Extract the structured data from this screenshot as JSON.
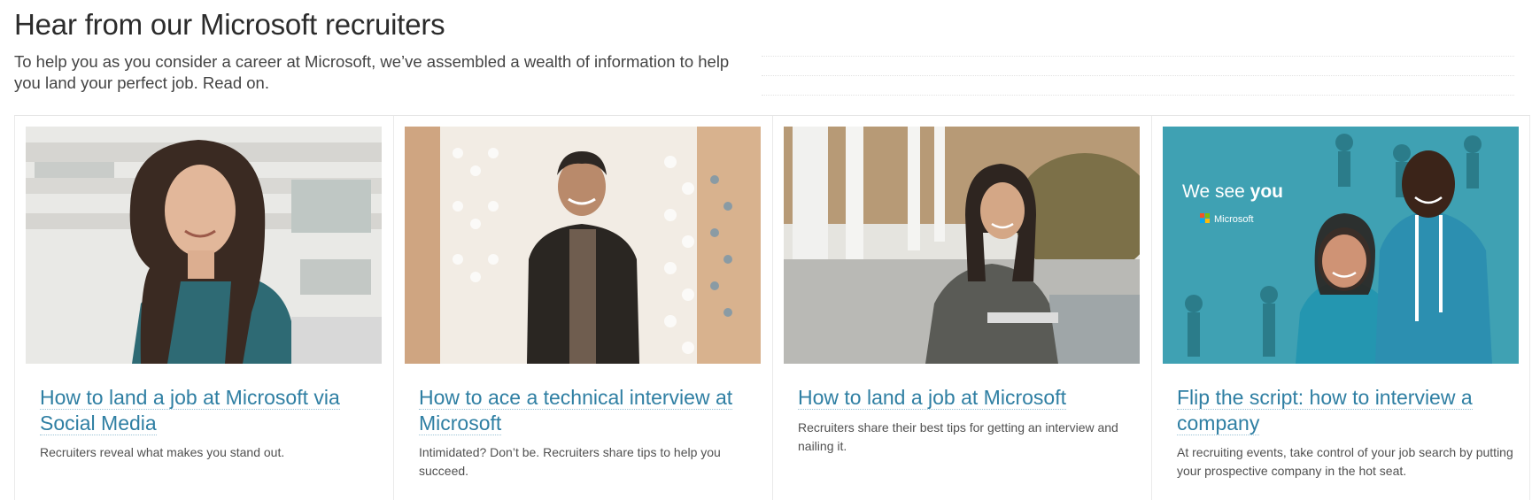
{
  "header": {
    "title": "Hear from our Microsoft recruiters",
    "intro": "To help you as you consider a career at Microsoft, we’ve assembled a wealth of information to help you land your perfect job. Read on."
  },
  "cards": [
    {
      "title": "How to land a job at Microsoft via Social Media",
      "description": "Recruiters reveal what makes you stand out."
    },
    {
      "title": "How to ace a technical interview at Microsoft",
      "description": "Intimidated? Don’t be. Recruiters share tips to help you succeed."
    },
    {
      "title": "How to land a job at Microsoft",
      "description": "Recruiters share their best tips for getting an interview and nailing it."
    },
    {
      "title": "Flip the script: how to interview a company",
      "description": "At recruiting events, take control of your job search by putting your prospective company in the hot seat.",
      "photo_text": {
        "headline_a": "We see ",
        "headline_b": "you",
        "brand": "Microsoft"
      }
    }
  ],
  "colors": {
    "link": "#2f7fa3",
    "teal_backdrop": "#3fa1b3"
  }
}
